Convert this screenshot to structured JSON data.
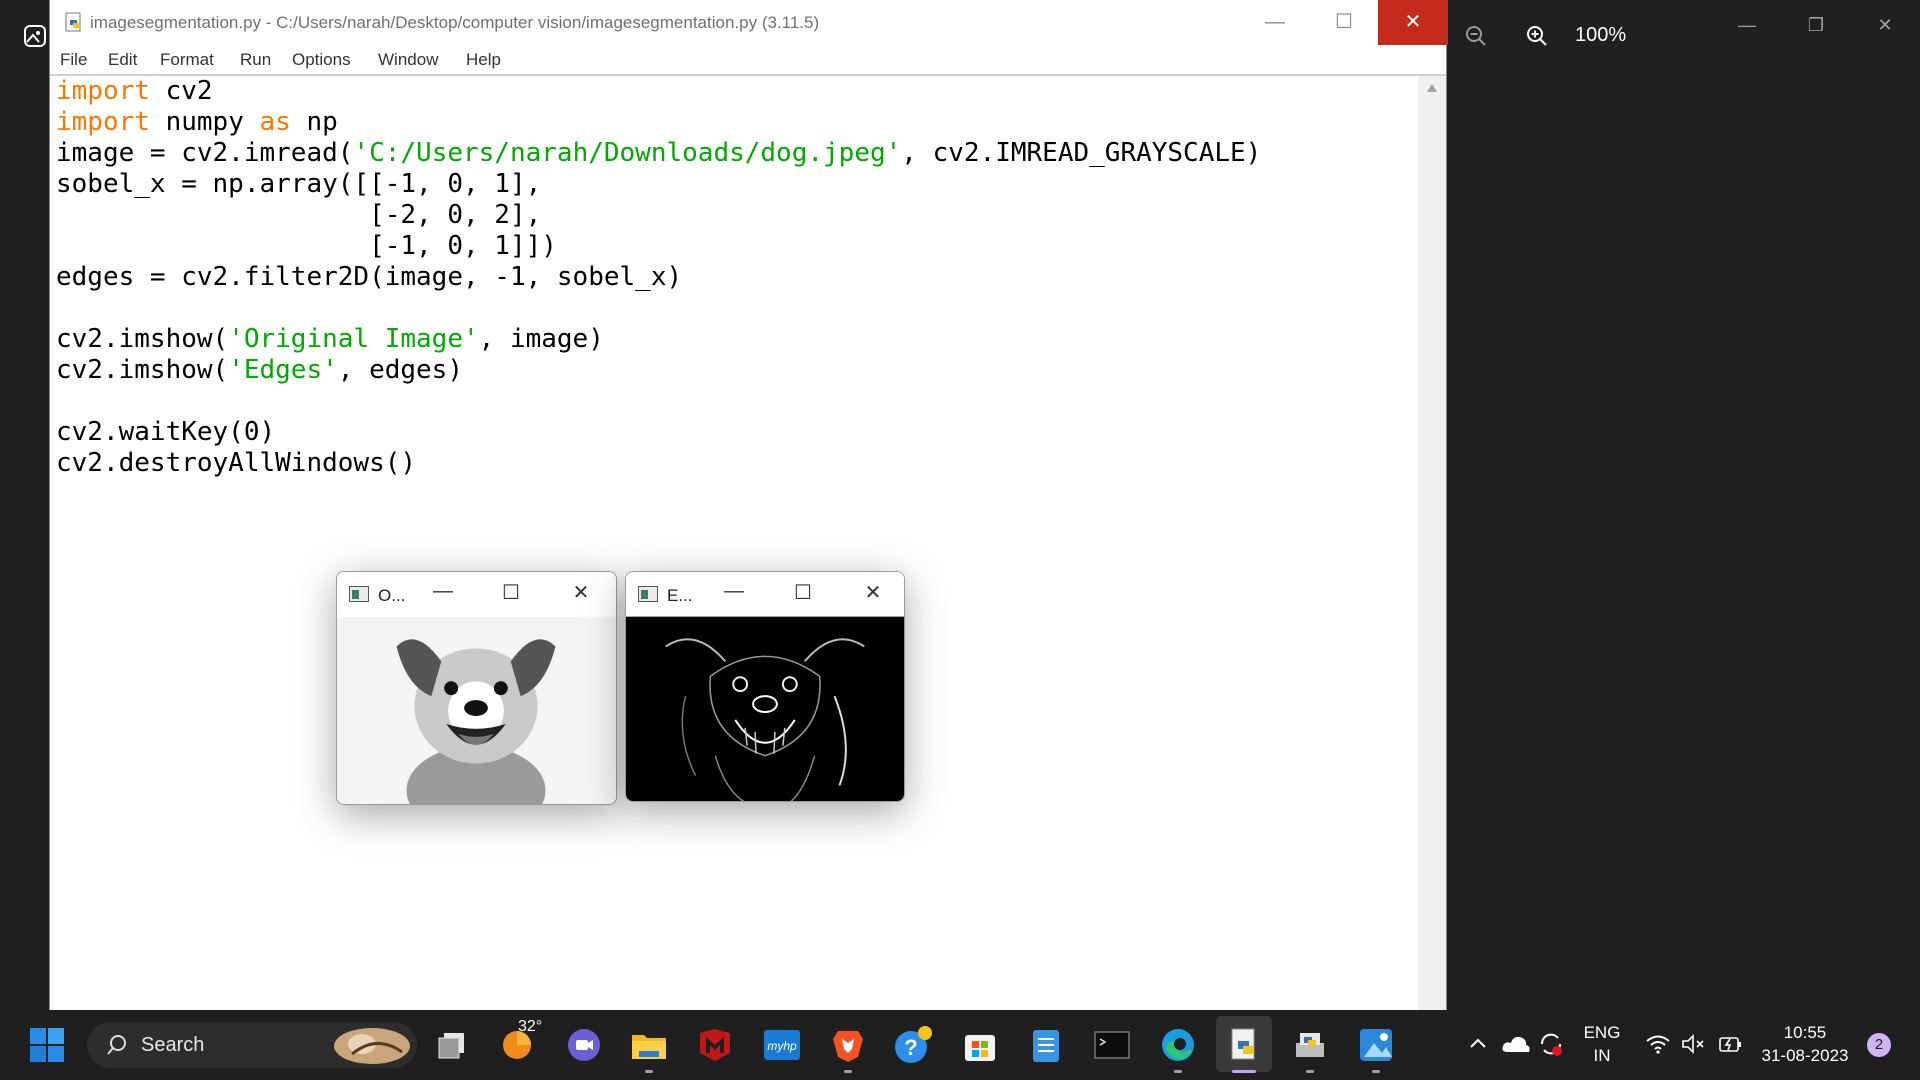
{
  "photos": {
    "zoom_level": "100%",
    "zoom_out_icon": "zoom-out-icon",
    "zoom_in_icon": "zoom-in-icon"
  },
  "idle": {
    "title": "imagesegmentation.py - C:/Users/narah/Desktop/computer vision/imagesegmentation.py (3.11.5)",
    "menu": [
      "File",
      "Edit",
      "Format",
      "Run",
      "Options",
      "Window",
      "Help"
    ],
    "code_lines": [
      "import cv2",
      "import numpy as np",
      "image = cv2.imread('C:/Users/narah/Downloads/dog.jpeg', cv2.IMREAD_GRAYSCALE)",
      "sobel_x = np.array([[-1, 0, 1],",
      "                    [-2, 0, 2],",
      "                    [-1, 0, 1]])",
      "edges = cv2.filter2D(image, -1, sobel_x)",
      "",
      "cv2.imshow('Original Image', image)",
      "cv2.imshow('Edges', edges)",
      "",
      "cv2.waitKey(0)",
      "cv2.destroyAllWindows()"
    ],
    "colors": {
      "keyword": "#ff7700",
      "string": "#00aa00"
    }
  },
  "windows": {
    "original": {
      "title": "O..."
    },
    "edges": {
      "title": "E..."
    }
  },
  "taskbar": {
    "search_label": "Search",
    "weather_temp": "32°",
    "language": "ENG",
    "region": "IN",
    "time": "10:55",
    "date": "31-08-2023",
    "notification_count": "2"
  }
}
